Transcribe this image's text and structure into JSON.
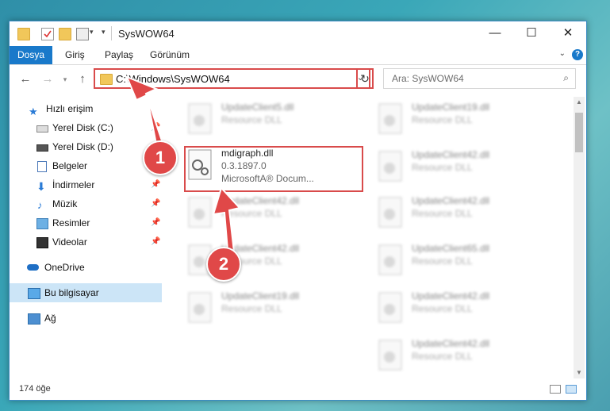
{
  "window": {
    "title": "SysWOW64",
    "controls": {
      "minimize": "—",
      "maximize": "☐",
      "close": "✕"
    }
  },
  "ribbon": {
    "tabs": [
      "Dosya",
      "Giriş",
      "Paylaş",
      "Görünüm"
    ],
    "help": "?"
  },
  "nav": {
    "address_path": "C:\\Windows\\SysWOW64",
    "search_placeholder": "Ara: SysWOW64"
  },
  "sidebar": {
    "items": [
      {
        "label": "Hızlı erişim",
        "icon": "star-icon"
      },
      {
        "label": "Yerel Disk (C:)",
        "icon": "drive-icon",
        "pinned": true
      },
      {
        "label": "Yerel Disk (D:)",
        "icon": "drive-icon"
      },
      {
        "label": "Belgeler",
        "icon": "documents-icon",
        "pinned": true
      },
      {
        "label": "İndirmeler",
        "icon": "downloads-icon",
        "pinned": true
      },
      {
        "label": "Müzik",
        "icon": "music-icon",
        "pinned": true
      },
      {
        "label": "Resimler",
        "icon": "pictures-icon",
        "pinned": true
      },
      {
        "label": "Videolar",
        "icon": "videos-icon",
        "pinned": true
      },
      {
        "label": "OneDrive",
        "icon": "onedrive-icon"
      },
      {
        "label": "Bu bilgisayar",
        "icon": "computer-icon",
        "selected": true
      },
      {
        "label": "Ağ",
        "icon": "network-icon"
      }
    ]
  },
  "files": {
    "highlighted": {
      "name": "mdigraph.dll",
      "version": "0.3.1897.0",
      "company": "MicrosoftA® Docum..."
    },
    "left_column": [
      {
        "name": "UpdateClient5.dll",
        "type": "Resource DLL"
      },
      {
        "name": "UpdateClient42.dll",
        "type": "Resource DLL"
      },
      {
        "name": "UpdateClient42.dll",
        "type": "Resource DLL"
      },
      {
        "name": "UpdateClient19.dll",
        "type": "Resource DLL"
      }
    ],
    "right_column": [
      {
        "name": "UpdateClient19.dll",
        "type": "Resource DLL"
      },
      {
        "name": "UpdateClient42.dll",
        "type": "Resource DLL"
      },
      {
        "name": "UpdateClient42.dll",
        "type": "Resource DLL"
      },
      {
        "name": "UpdateClient65.dll",
        "type": "Resource DLL"
      },
      {
        "name": "UpdateClient42.dll",
        "type": "Resource DLL"
      },
      {
        "name": "UpdateClient42.dll",
        "type": "Resource DLL"
      }
    ]
  },
  "status": {
    "item_count": "174 öğe"
  },
  "annotations": {
    "step1": "1",
    "step2": "2",
    "color": "#e04848"
  }
}
